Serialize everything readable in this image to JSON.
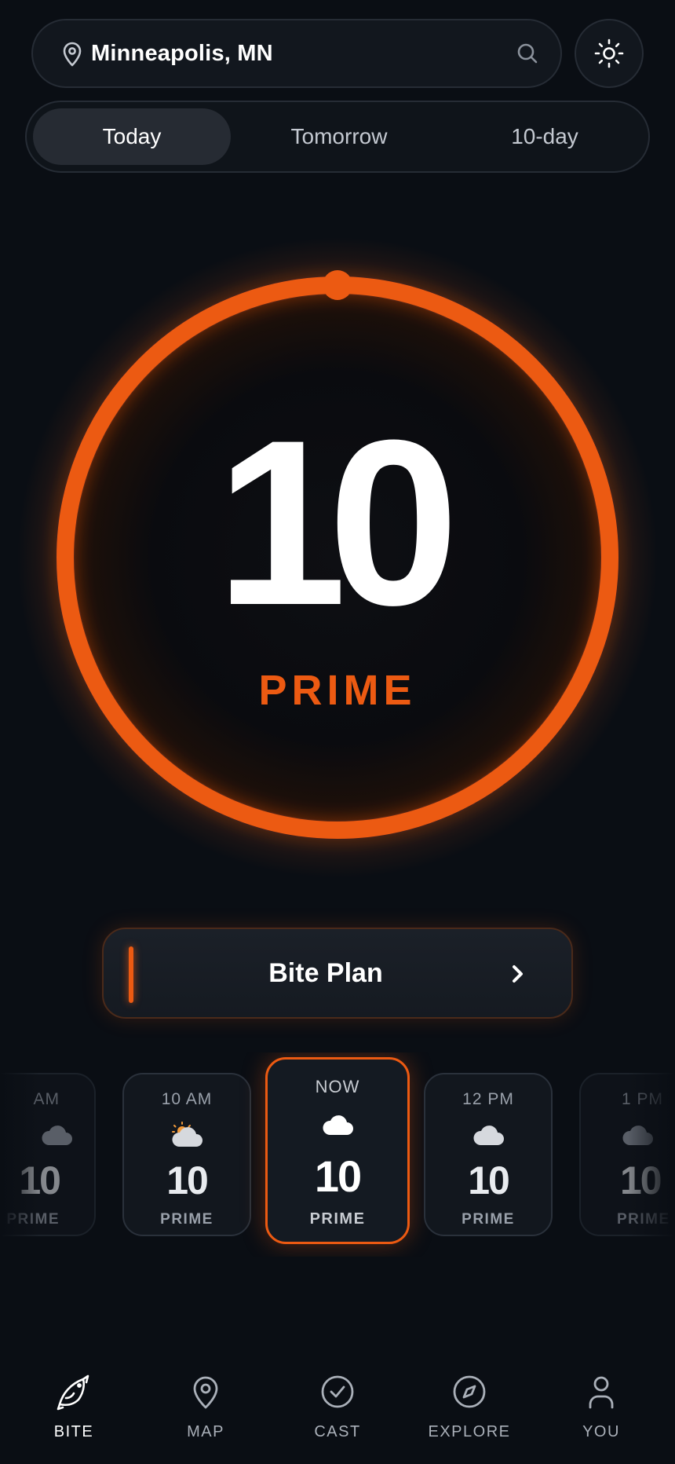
{
  "location": {
    "name": "Minneapolis, MN",
    "location_icon": "map-pin-icon",
    "search_icon": "search-icon",
    "theme_icon": "sun-icon"
  },
  "tabs": [
    {
      "label": "Today",
      "active": true
    },
    {
      "label": "Tomorrow",
      "active": false
    },
    {
      "label": "10-day",
      "active": false
    }
  ],
  "score": {
    "value": "10",
    "label": "PRIME",
    "fraction": 1.0,
    "accent_color": "#ec5a12"
  },
  "bite_plan": {
    "label": "Bite Plan",
    "chevron_icon": "chevron-right-icon"
  },
  "hourly": [
    {
      "time": "AM",
      "icon": "cloud-icon",
      "value": "10",
      "label": "PRIME"
    },
    {
      "time": "10 AM",
      "icon": "partly-cloudy-icon",
      "value": "10",
      "label": "PRIME"
    },
    {
      "time": "NOW",
      "icon": "cloud-icon",
      "value": "10",
      "label": "PRIME",
      "current": true
    },
    {
      "time": "12 PM",
      "icon": "cloud-icon",
      "value": "10",
      "label": "PRIME"
    },
    {
      "time": "1 PM",
      "icon": "cloud-icon",
      "value": "10",
      "label": "PRIME"
    }
  ],
  "nav": [
    {
      "label": "BITE",
      "icon": "fish-icon",
      "active": true
    },
    {
      "label": "MAP",
      "icon": "map-pin-icon",
      "active": false
    },
    {
      "label": "CAST",
      "icon": "check-circle-icon",
      "active": false
    },
    {
      "label": "EXPLORE",
      "icon": "compass-icon",
      "active": false
    },
    {
      "label": "YOU",
      "icon": "user-icon",
      "active": false
    }
  ]
}
